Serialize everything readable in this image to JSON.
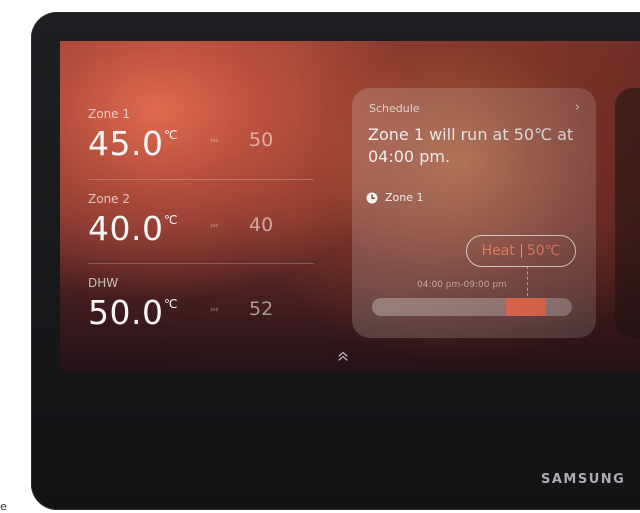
{
  "zones": [
    {
      "label": "Zone 1",
      "temp": "45.0",
      "unit": "℃",
      "arrows": "›››",
      "target": "50"
    },
    {
      "label": "Zone 2",
      "temp": "40.0",
      "unit": "℃",
      "arrows": "›››",
      "target": "40"
    },
    {
      "label": "DHW",
      "temp": "50.0",
      "unit": "℃",
      "arrows": "›››",
      "target": "52"
    }
  ],
  "schedule": {
    "title": "Schedule",
    "chevron": "›",
    "message": "Zone 1 will run at 50℃ at 04:00 pm.",
    "zone_label": "Zone 1",
    "mode": "Heat",
    "mode_temp": "50℃",
    "time_range": "04:00 pm-09:00 pm"
  },
  "brand": "SAMSUNG",
  "stray_text": "e",
  "colors": {
    "accent": "#f57457",
    "heat_text": "#ff8a6e",
    "bezel": "#17181b"
  },
  "icons": {
    "clock": "clock-icon",
    "expand": "chevron-double-up-icon",
    "chevron": "chevron-right-icon"
  }
}
